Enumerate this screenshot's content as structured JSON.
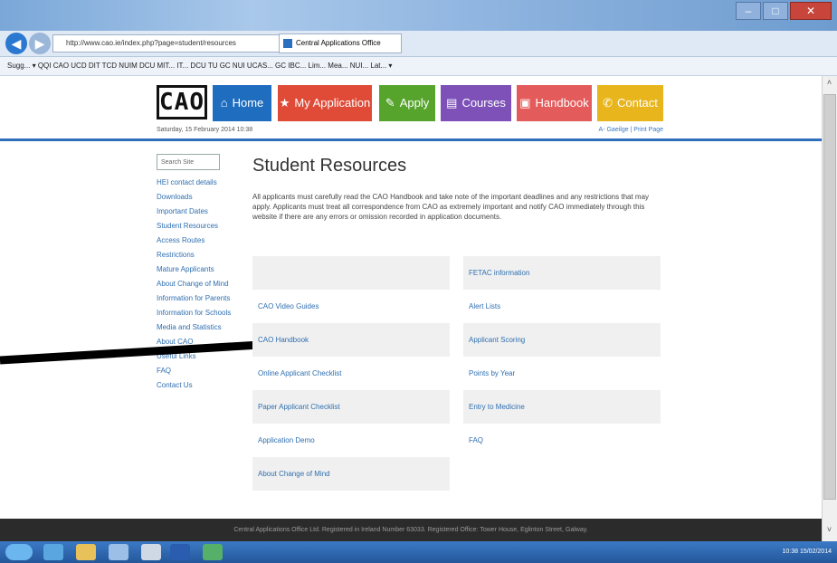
{
  "browser": {
    "address": "http://www.cao.ie/index.php?page=student/resources",
    "tab_title": "Central Applications Office",
    "favorites": "Sugg... ▾  QQI  CAO  UCD  DIT  TCD  NUIM  DCU  MIT...  IT...  DCU  TU  GC  NUI  UCAS...  GC  IBC...  Lim...  Mea...  NUI...  Lat... ▾"
  },
  "site": {
    "logo": "CAO",
    "nav": [
      {
        "label": "Home",
        "icon": "⌂",
        "color": "#1f6dbf"
      },
      {
        "label": "My Application",
        "icon": "★",
        "color": "#e04b38"
      },
      {
        "label": "Apply",
        "icon": "✎",
        "color": "#57a42d"
      },
      {
        "label": "Courses",
        "icon": "▤",
        "color": "#7d51b8"
      },
      {
        "label": "Handbook",
        "icon": "▣",
        "color": "#e45b5b"
      },
      {
        "label": "Contact",
        "icon": "✆",
        "color": "#e8b51c"
      }
    ],
    "date": "Saturday, 15 February 2014 10:38",
    "top_links": "A- Gaeilge | Print Page"
  },
  "sidebar": {
    "search_placeholder": "Search Site",
    "items": [
      "HEI contact details",
      "Downloads",
      "Important Dates",
      "Student Resources",
      "Access Routes",
      "Restrictions",
      "Mature Applicants",
      "About Change of Mind",
      "Information for Parents",
      "Information for Schools",
      "Media and Statistics",
      "About CAO",
      "Useful Links",
      "FAQ",
      "Contact Us"
    ]
  },
  "main": {
    "title": "Student Resources",
    "intro": "All applicants must carefully read the CAO Handbook and take note of the important deadlines and any restrictions that may apply. Applicants must treat all correspondence from CAO as extremely important and notify CAO immediately through this website if there are any errors or omission recorded in application documents.",
    "left_col": [
      "",
      "CAO Video Guides",
      "CAO Handbook",
      "Online Applicant Checklist",
      "Paper Applicant Checklist",
      "Application Demo",
      "About Change of Mind"
    ],
    "right_col": [
      "FETAC information",
      "Alert Lists",
      "Applicant Scoring",
      "Points by Year",
      "Entry to Medicine",
      "FAQ"
    ]
  },
  "footer": {
    "text": "Central Applications Office Ltd. Registered in Ireland Number 63033. Registered Office: Tower House, Eglinton Street, Galway."
  },
  "taskbar": {
    "tray_time": "10:38",
    "tray_date": "15/02/2014"
  }
}
